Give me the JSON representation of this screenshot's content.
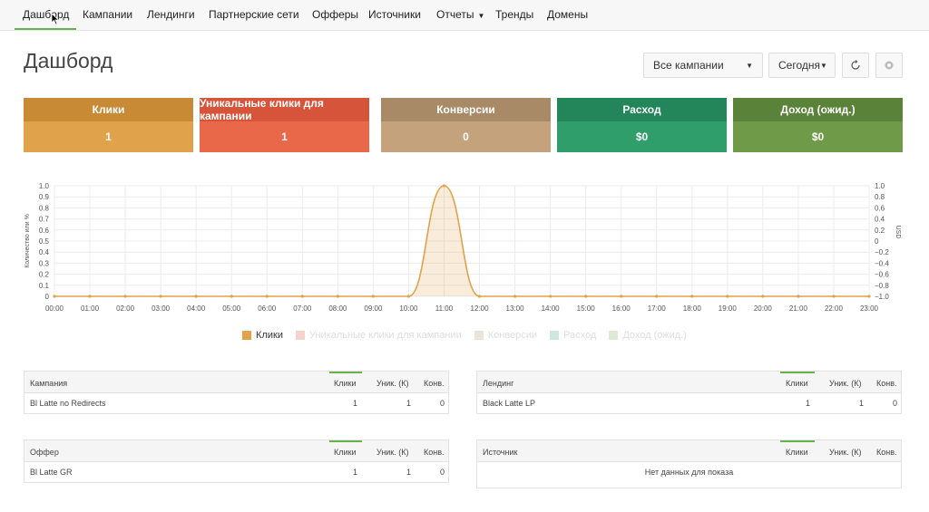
{
  "nav": {
    "items": [
      {
        "label": "Дашборд",
        "active": true
      },
      {
        "label": "Кампании"
      },
      {
        "label": "Лендинги"
      },
      {
        "label": "Партнерские сети"
      },
      {
        "label": "Офферы"
      },
      {
        "label": "Источники"
      },
      {
        "label": "Отчеты",
        "dropdown": true
      },
      {
        "label": "Тренды"
      },
      {
        "label": "Домены"
      }
    ]
  },
  "page": {
    "title": "Дашборд",
    "campaign_filter": "Все кампании",
    "date_filter": "Сегодня"
  },
  "cards": [
    {
      "label": "Клики",
      "value": "1",
      "color": "#e0a24a"
    },
    {
      "label": "Уникальные клики для кампании",
      "value": "1",
      "color": "#e9684a"
    },
    {
      "label": "Конверсии",
      "value": "0",
      "color": "#c4a27c"
    },
    {
      "label": "Расход",
      "value": "$0",
      "color": "#2f9e6a"
    },
    {
      "label": "Доход (ожид.)",
      "value": "$0",
      "color": "#6f9a48"
    }
  ],
  "chart_data": {
    "type": "area",
    "x": [
      "00:00",
      "01:00",
      "02:00",
      "03:00",
      "04:00",
      "05:00",
      "06:00",
      "07:00",
      "08:00",
      "09:00",
      "10:00",
      "11:00",
      "12:00",
      "13:00",
      "14:00",
      "15:00",
      "16:00",
      "17:00",
      "18:00",
      "19:00",
      "20:00",
      "21:00",
      "22:00",
      "23:00"
    ],
    "series": [
      {
        "name": "Клики",
        "values": [
          0,
          0,
          0,
          0,
          0,
          0,
          0,
          0,
          0,
          0,
          0,
          1,
          0,
          0,
          0,
          0,
          0,
          0,
          0,
          0,
          0,
          0,
          0,
          0
        ],
        "color": "#e0a24a",
        "visible": true
      },
      {
        "name": "Уникальные клики для кампании",
        "visible": false,
        "color": "#f6d3ca"
      },
      {
        "name": "Конверсии",
        "visible": false,
        "color": "#ede3d6"
      },
      {
        "name": "Расход",
        "visible": false,
        "color": "#cfe8dc"
      },
      {
        "name": "Доход (ожид.)",
        "visible": false,
        "color": "#dfe9d3"
      }
    ],
    "ylabel": "Количество или %",
    "y2label": "USD",
    "ylim": [
      0,
      1.0
    ],
    "yticks": [
      "0",
      "0.1",
      "0.2",
      "0.3",
      "0.4",
      "0.5",
      "0.6",
      "0.7",
      "0.8",
      "0.9",
      "1.0"
    ],
    "y2lim": [
      -1.0,
      1.0
    ],
    "y2ticks": [
      "−1.0",
      "−0.8",
      "−0.6",
      "−0.4",
      "−0.2",
      "0",
      "0.2",
      "0.4",
      "0.6",
      "0.8",
      "1.0"
    ],
    "grid": true,
    "legend": "bottom"
  },
  "tables": {
    "campaigns": {
      "headers": [
        "Кампания",
        "Клики",
        "Уник. (К)",
        "Конв."
      ],
      "rows": [
        [
          "Bl Latte no Redirects",
          "1",
          "1",
          "0"
        ]
      ]
    },
    "landings": {
      "headers": [
        "Лендинг",
        "Клики",
        "Уник. (К)",
        "Конв."
      ],
      "rows": [
        [
          "Black Latte LP",
          "1",
          "1",
          "0"
        ]
      ]
    },
    "offers": {
      "headers": [
        "Оффер",
        "Клики",
        "Уник. (К)",
        "Конв."
      ],
      "rows": [
        [
          "Bl Latte GR",
          "1",
          "1",
          "0"
        ]
      ]
    },
    "sources": {
      "headers": [
        "Источник",
        "Клики",
        "Уник. (К)",
        "Конв."
      ],
      "empty": "Нет данных для показа"
    }
  }
}
